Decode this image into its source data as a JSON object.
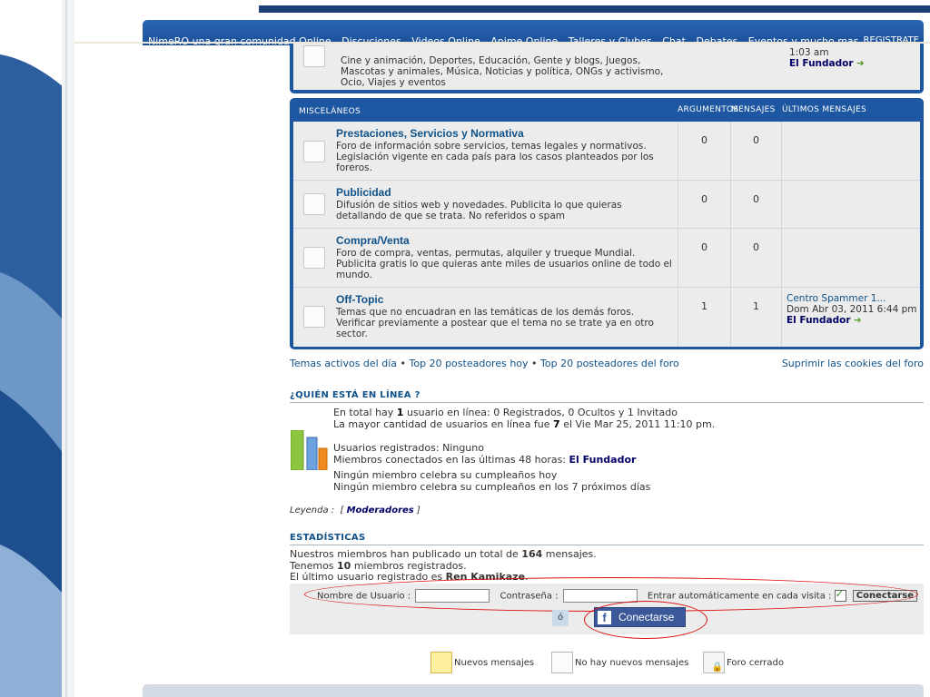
{
  "nav": {
    "links": [
      "NimeRO una gran comunidad Online",
      "Discuciones",
      "Videos Online",
      "Anime Online",
      "Talleres y Clubes",
      "Chat",
      "Debates",
      "Eventos y mucho mas"
    ],
    "register": "REGISTRATE"
  },
  "top_forum": {
    "desc": "Cine y animación, Deportes, Educación, Gente y blogs, Juegos, Mascotas y animales, Música, Noticias y política, ONGs y activismo, Ocio, Viajes y eventos",
    "last_time": "1:03 am",
    "last_user": "El Fundador"
  },
  "misc": {
    "title": "MISCELÁNEOS",
    "col_topics": "ARGUMENTOS",
    "col_posts": "MENSAJES",
    "col_last": "ÚLTIMOS MENSAJES",
    "forums": [
      {
        "name": "Prestaciones, Servicios y Normativa",
        "desc": "Foro de información sobre servicios, temas legales y normativos. Legislación vigente en cada país para los casos planteados por los foreros.",
        "topics": "0",
        "posts": "0"
      },
      {
        "name": "Publicidad",
        "desc": "Difusión de sitios web y novedades. Publicita lo que quieras detallando de que se trata. No referidos o spam",
        "topics": "0",
        "posts": "0"
      },
      {
        "name": "Compra/Venta",
        "desc": "Foro de compra, ventas, permutas, alquiler y trueque Mundial. Publicita gratis lo que quieras ante miles de usuarios online de todo el mundo.",
        "topics": "0",
        "posts": "0"
      },
      {
        "name": "Off-Topic",
        "desc": "Temas que no encuadran en las temáticas de los demás foros. Verificar previamente a postear que el tema no se trate ya en otro sector.",
        "topics": "1",
        "posts": "1",
        "last_post": "Centro Spammer 1...",
        "last_date": "Dom Abr 03, 2011 6:44 pm",
        "last_user": "El Fundador"
      }
    ]
  },
  "actions": {
    "active": "Temas activos del día",
    "top_today": "Top 20 posteadores hoy",
    "top_forum": "Top 20 posteadores del foro",
    "cookies": "Suprimir las cookies del foro"
  },
  "online": {
    "title": "¿QUIÉN ESTÁ EN LÍNEA ?",
    "line1_a": "En total hay ",
    "line1_b": "1",
    "line1_c": " usuario en línea: 0 Registrados, 0 Ocultos y 1 Invitado",
    "line2_a": "La mayor cantidad de usuarios en línea fue ",
    "line2_b": "7",
    "line2_c": " el Vie Mar 25, 2011 11:10 pm.",
    "registered": "Usuarios registrados: Ninguno",
    "last48": "Miembros conectados en las últimas 48 horas: ",
    "last48_user": "El Fundador",
    "birthday1": "Ningún miembro celebra su cumpleaños hoy",
    "birthday2": "Ningún miembro celebra su cumpleaños en los 7 próximos días",
    "legend_label": "Leyenda :",
    "legend_mod": "Moderadores"
  },
  "stats": {
    "title": "ESTADÍSTICAS",
    "l1_a": "Nuestros miembros han publicado un total de ",
    "l1_b": "164",
    "l1_c": " mensajes.",
    "l2_a": "Tenemos ",
    "l2_b": "10",
    "l2_c": " miembros registrados.",
    "l3_a": "El último usuario registrado es ",
    "l3_b": "Ren Kamikaze",
    "l3_c": "."
  },
  "login": {
    "user_label": "Nombre de Usuario :",
    "pass_label": "Contraseña :",
    "auto_label": "Entrar automáticamente en cada visita :",
    "button": "Conectarse",
    "or": "ó",
    "fb_button": "Conectarse"
  },
  "legend_icons": {
    "new": "Nuevos mensajes",
    "nonew": "No hay nuevos mensajes",
    "locked": "Foro cerrado"
  },
  "colors": {
    "nav_blue": "#1d57a1",
    "link": "#105289",
    "facebook": "#3b5998",
    "annotation_red": "#dd1111"
  }
}
